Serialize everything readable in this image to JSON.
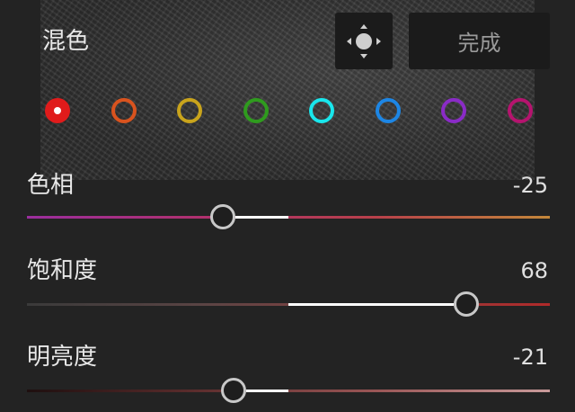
{
  "header": {
    "title": "混色",
    "target_icon": "target-move-icon",
    "done_label": "完成"
  },
  "swatches": [
    {
      "name": "red",
      "color": "#e01b1b",
      "selected": true
    },
    {
      "name": "orange",
      "color": "#d9531e",
      "selected": false
    },
    {
      "name": "yellow",
      "color": "#c9a41c",
      "selected": false
    },
    {
      "name": "green",
      "color": "#2f9b1e",
      "selected": false
    },
    {
      "name": "aqua",
      "color": "#19e6ec",
      "selected": false
    },
    {
      "name": "blue",
      "color": "#1d86e4",
      "selected": false
    },
    {
      "name": "purple",
      "color": "#8a2bc7",
      "selected": false
    },
    {
      "name": "magenta",
      "color": "#b5146e",
      "selected": false
    }
  ],
  "sliders": [
    {
      "key": "hue",
      "label": "色相",
      "value": "-25",
      "number": -25,
      "min": -100,
      "max": 100,
      "gradient": [
        "#9b2e9e",
        "#b0306e",
        "#b8404a",
        "#c3873a"
      ]
    },
    {
      "key": "saturation",
      "label": "饱和度",
      "value": "68",
      "number": 68,
      "min": -100,
      "max": 100,
      "gradient": [
        "#3a3a3a",
        "#5a4444",
        "#8a4040",
        "#b02a2a"
      ]
    },
    {
      "key": "luminance",
      "label": "明亮度",
      "value": "-21",
      "number": -21,
      "min": -100,
      "max": 100,
      "gradient": [
        "#1e0f0f",
        "#5e2e2e",
        "#9a5656",
        "#c89a9a"
      ]
    }
  ]
}
